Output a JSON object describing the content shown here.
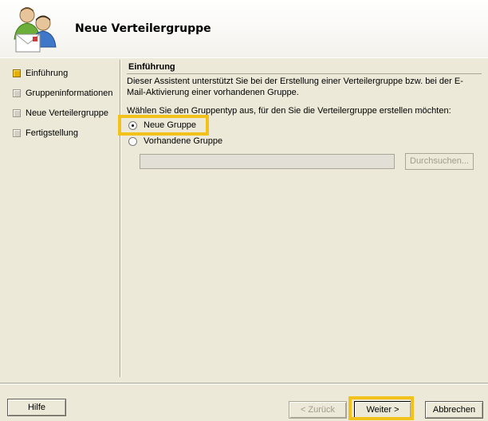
{
  "header": {
    "title": "Neue Verteilergruppe",
    "icon": "group-users-icon"
  },
  "sidebar": {
    "steps": [
      {
        "label": "Einführung",
        "active": true
      },
      {
        "label": "Gruppeninformationen",
        "active": false
      },
      {
        "label": "Neue Verteilergruppe",
        "active": false
      },
      {
        "label": "Fertigstellung",
        "active": false
      }
    ]
  },
  "main": {
    "section_title": "Einführung",
    "description": "Dieser Assistent unterstützt Sie bei der Erstellung einer Verteilergruppe bzw. bei der E-Mail-Aktivierung einer vorhandenen Gruppe.",
    "prompt": "Wählen Sie den Gruppentyp aus, für den Sie die Verteilergruppe erstellen möchten:",
    "options": [
      {
        "label": "Neue Gruppe",
        "checked": true
      },
      {
        "label": "Vorhandene Gruppe",
        "checked": false
      }
    ],
    "browse_value": "",
    "browse_label": "Durchsuchen..."
  },
  "footer": {
    "help_label": "Hilfe",
    "back_label": "< Zurück",
    "next_label": "Weiter >",
    "cancel_label": "Abbrechen"
  },
  "colors": {
    "highlight": "#f2c21a",
    "active_step": "#e4b008",
    "background": "#ece9d8"
  }
}
